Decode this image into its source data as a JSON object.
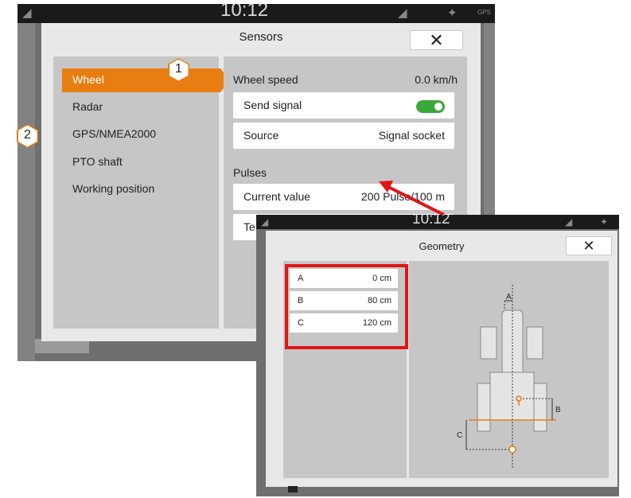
{
  "sensors_screen": {
    "status_bar": {
      "time": "10:12",
      "gps_text": "GPS"
    },
    "dialog": {
      "title": "Sensors",
      "close_symbol": "✕",
      "sidebar_items": [
        {
          "label": "Wheel",
          "active": true
        },
        {
          "label": "Radar"
        },
        {
          "label": "GPS/NMEA2000"
        },
        {
          "label": "PTO shaft"
        },
        {
          "label": "Working position"
        }
      ],
      "content": {
        "header_label": "Wheel speed",
        "header_value": "0.0 km/h",
        "send_signal_label": "Send signal",
        "send_signal_state": true,
        "source_label": "Source",
        "source_value": "Signal socket",
        "pulses_label": "Pulses",
        "current_value_label": "Current value",
        "current_value_value": "200 Pulse/100 m",
        "teach_label": "Te"
      }
    },
    "callouts": [
      "1",
      "2"
    ]
  },
  "geometry_screen": {
    "status_bar": {
      "time": "10:12"
    },
    "dialog": {
      "title": "Geometry",
      "close_symbol": "✕",
      "rows": [
        {
          "label": "A",
          "value": "0 cm"
        },
        {
          "label": "B",
          "value": "80 cm"
        },
        {
          "label": "C",
          "value": "120 cm"
        }
      ],
      "diagram_labels": {
        "a": "A",
        "b": "B",
        "c": "C"
      }
    }
  },
  "colors": {
    "accent": "#e87e12",
    "toggle_on": "#3aa83a",
    "highlight": "#e01515",
    "panel": "#c6c6c6",
    "dialog_bg": "#e8e8e8"
  },
  "icons": [
    "signal-icon",
    "satellite-icon",
    "close-icon",
    "arrow-icon",
    "tractor-diagram"
  ]
}
